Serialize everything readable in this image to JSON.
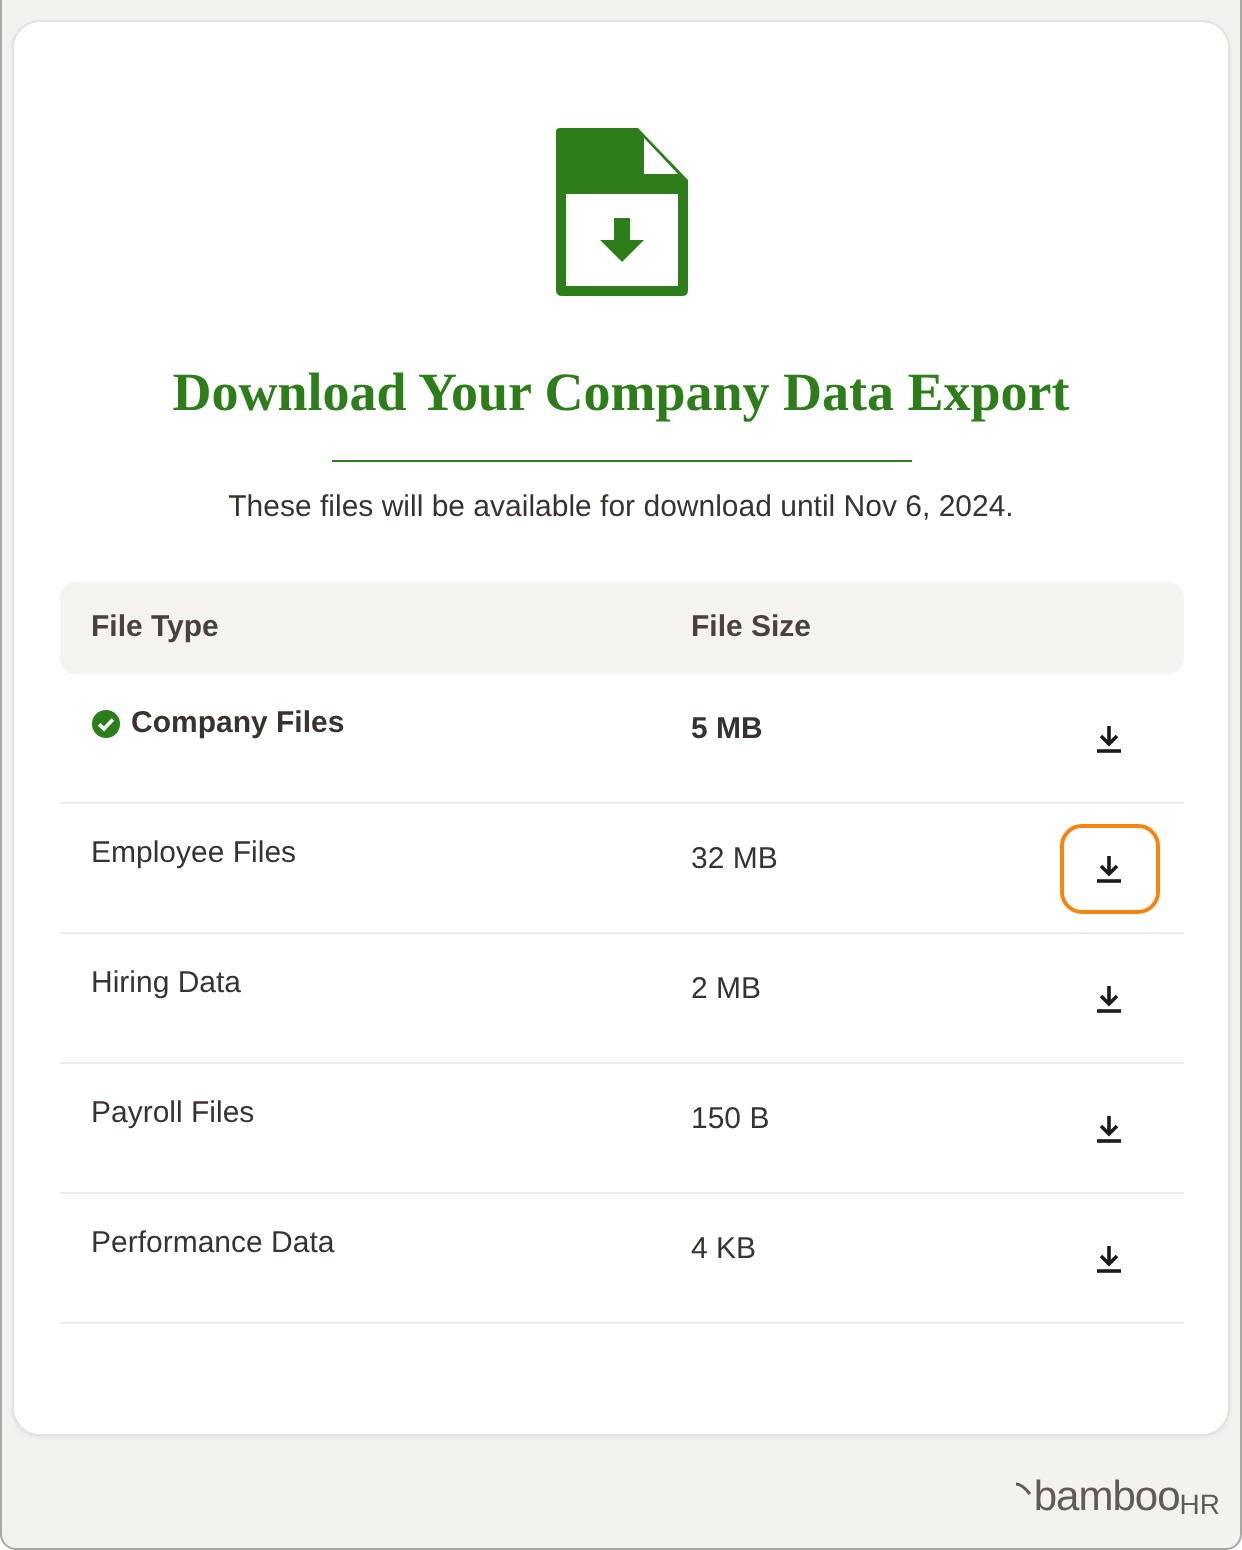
{
  "header": {
    "title": "Download Your Company Data Export",
    "subtitle": "These files will be available for download until Nov 6, 2024."
  },
  "table": {
    "columns": [
      "File Type",
      "File Size"
    ],
    "rows": [
      {
        "file_type": "Company Files",
        "file_size": "5 MB",
        "completed": true,
        "focused": false
      },
      {
        "file_type": "Employee Files",
        "file_size": "32 MB",
        "completed": false,
        "focused": true
      },
      {
        "file_type": "Hiring Data",
        "file_size": "2 MB",
        "completed": false,
        "focused": false
      },
      {
        "file_type": "Payroll Files",
        "file_size": "150 B",
        "completed": false,
        "focused": false
      },
      {
        "file_type": "Performance Data",
        "file_size": "4 KB",
        "completed": false,
        "focused": false
      }
    ]
  },
  "footer": {
    "logo": {
      "name": "bamboo",
      "suffix": "HR"
    }
  }
}
